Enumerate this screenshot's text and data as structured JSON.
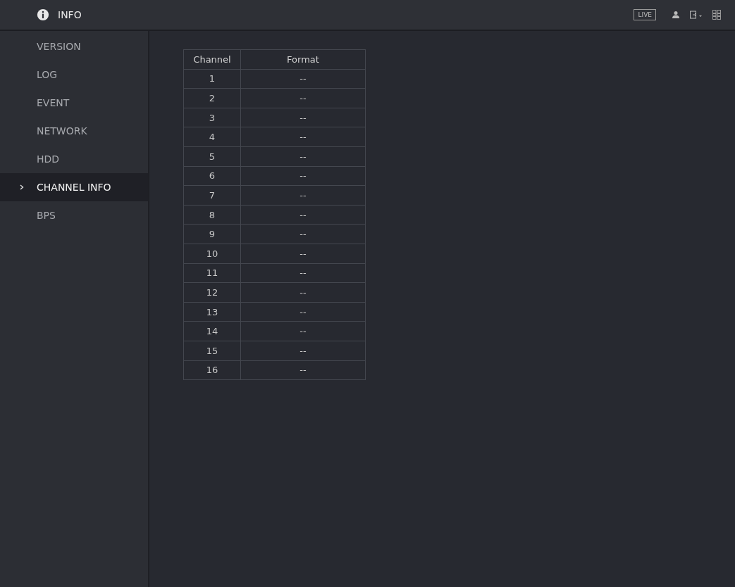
{
  "header": {
    "title": "INFO",
    "live_button": "LIVE"
  },
  "sidebar": {
    "items": [
      {
        "label": "VERSION",
        "selected": false
      },
      {
        "label": "LOG",
        "selected": false
      },
      {
        "label": "EVENT",
        "selected": false
      },
      {
        "label": "NETWORK",
        "selected": false
      },
      {
        "label": "HDD",
        "selected": false
      },
      {
        "label": "CHANNEL INFO",
        "selected": true
      },
      {
        "label": "BPS",
        "selected": false
      }
    ]
  },
  "table": {
    "columns": [
      "Channel",
      "Format"
    ],
    "rows": [
      [
        "1",
        "--"
      ],
      [
        "2",
        "--"
      ],
      [
        "3",
        "--"
      ],
      [
        "4",
        "--"
      ],
      [
        "5",
        "--"
      ],
      [
        "6",
        "--"
      ],
      [
        "7",
        "--"
      ],
      [
        "8",
        "--"
      ],
      [
        "9",
        "--"
      ],
      [
        "10",
        "--"
      ],
      [
        "11",
        "--"
      ],
      [
        "12",
        "--"
      ],
      [
        "13",
        "--"
      ],
      [
        "14",
        "--"
      ],
      [
        "15",
        "--"
      ],
      [
        "16",
        "--"
      ]
    ]
  }
}
